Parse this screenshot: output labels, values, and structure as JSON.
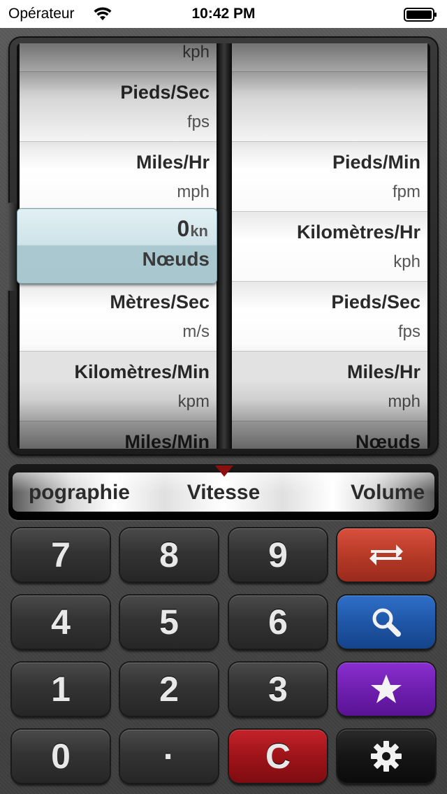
{
  "status_bar": {
    "carrier": "Opérateur",
    "time": "10:42 PM"
  },
  "converter": {
    "input_value": "0",
    "input_unit_abbr": "kn",
    "input_unit_name": "Nœuds",
    "left_wheel": [
      {
        "name": "",
        "abbr": "kph"
      },
      {
        "name": "Pieds/Sec",
        "abbr": "fps"
      },
      {
        "name": "Miles/Hr",
        "abbr": "mph"
      },
      {
        "name": "",
        "abbr": ""
      },
      {
        "name": "Mètres/Sec",
        "abbr": "m/s"
      },
      {
        "name": "Kilomètres/Min",
        "abbr": "kpm"
      },
      {
        "name": "Miles/Min",
        "abbr": ""
      }
    ],
    "right_wheel": [
      {
        "name": "",
        "abbr": ""
      },
      {
        "name": "",
        "abbr": ""
      },
      {
        "name": "Pieds/Min",
        "abbr": "fpm"
      },
      {
        "name": "Kilomètres/Hr",
        "abbr": "kph"
      },
      {
        "name": "Pieds/Sec",
        "abbr": "fps"
      },
      {
        "name": "Miles/Hr",
        "abbr": "mph"
      },
      {
        "name": "Nœuds",
        "abbr": ""
      }
    ]
  },
  "categories": {
    "previous": "pographie",
    "current": "Vitesse",
    "next": "Volume"
  },
  "keypad": {
    "digits": [
      "7",
      "8",
      "9",
      "4",
      "5",
      "6",
      "1",
      "2",
      "3",
      "0",
      "·"
    ],
    "clear": "C",
    "colors": {
      "swap": "#c4422f",
      "search": "#1f57a8",
      "favorite": "#6f1fb0",
      "clear": "#9e1419",
      "settings": "#151515"
    },
    "icons": [
      "swap-icon",
      "search-icon",
      "star-icon",
      "gear-icon"
    ]
  }
}
